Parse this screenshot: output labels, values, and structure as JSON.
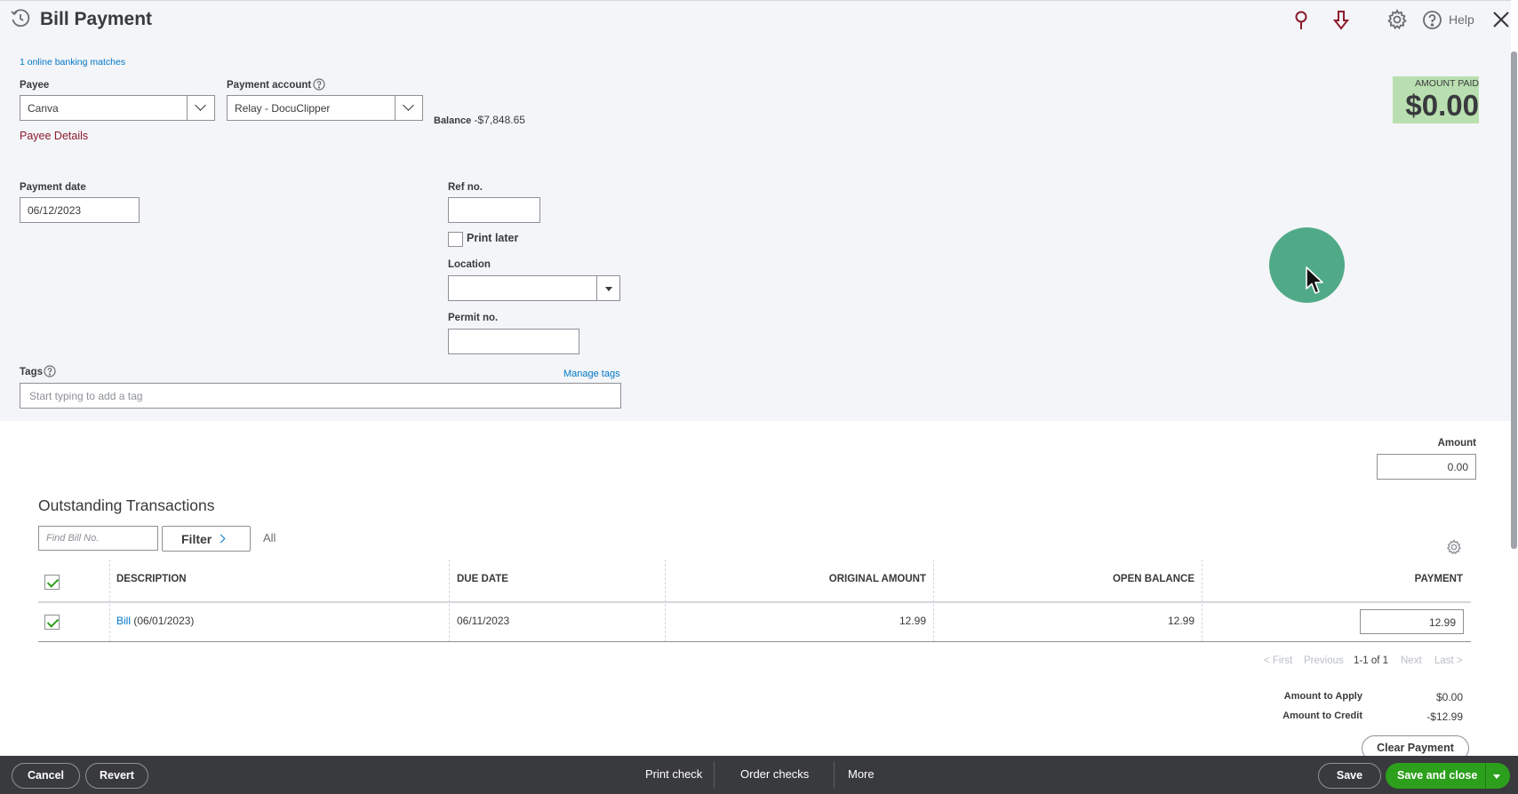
{
  "header": {
    "title": "Bill Payment",
    "help_label": "Help"
  },
  "form": {
    "banking_matches_link": "1 online banking matches",
    "payee_label": "Payee",
    "payee_value": "Canva",
    "payee_details_link": "Payee Details",
    "payment_account_label": "Payment account",
    "payment_account_value": "Relay - DocuClipper",
    "balance_label": "Balance",
    "balance_value": "-$7,848.65",
    "amount_paid_label": "AMOUNT PAID",
    "amount_paid_value": "$0.00",
    "payment_date_label": "Payment date",
    "payment_date_value": "06/12/2023",
    "ref_no_label": "Ref no.",
    "ref_no_value": "",
    "print_later_label": "Print later",
    "location_label": "Location",
    "location_value": "",
    "permit_no_label": "Permit no.",
    "permit_no_value": "",
    "tags_label": "Tags",
    "manage_tags_link": "Manage tags",
    "tags_placeholder": "Start typing to add a tag"
  },
  "amount": {
    "label": "Amount",
    "value": "0.00"
  },
  "transactions": {
    "heading": "Outstanding Transactions",
    "find_placeholder": "Find Bill No.",
    "filter_label": "Filter",
    "filter_value": "All",
    "columns": [
      "DESCRIPTION",
      "DUE DATE",
      "ORIGINAL AMOUNT",
      "OPEN BALANCE",
      "PAYMENT"
    ],
    "rows": [
      {
        "checked": true,
        "description_link": "Bill",
        "description_date": "(06/01/2023)",
        "due_date": "06/11/2023",
        "original_amount": "12.99",
        "open_balance": "12.99",
        "payment": "12.99"
      }
    ],
    "pager": {
      "first": "< First",
      "previous": "Previous",
      "range": "1-1 of 1",
      "next": "Next",
      "last": "Last >"
    },
    "amount_to_apply_label": "Amount to Apply",
    "amount_to_apply_value": "$0.00",
    "amount_to_credit_label": "Amount to Credit",
    "amount_to_credit_value": "-$12.99",
    "clear_payment_label": "Clear Payment"
  },
  "footer": {
    "cancel_label": "Cancel",
    "revert_label": "Revert",
    "print_check_label": "Print check",
    "order_checks_label": "Order checks",
    "more_label": "More",
    "save_label": "Save",
    "save_and_close_label": "Save and close"
  },
  "colors": {
    "brand_green": "#2ca01c",
    "link_blue": "#0077c5",
    "payee_details_red": "#8b1c2c",
    "amount_paid_highlight": "#b9dfb0",
    "cursor_highlight": "#3fa27a"
  },
  "icons": [
    "history-icon",
    "location-pin-icon",
    "download-arrow-icon",
    "gear-icon",
    "help-icon",
    "close-icon"
  ]
}
